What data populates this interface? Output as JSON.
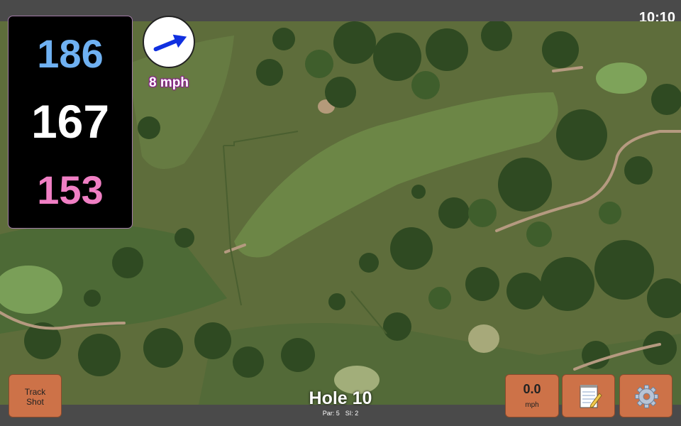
{
  "status_bar": {
    "time": "10:10"
  },
  "distances": {
    "back": {
      "value": "186",
      "color": "#6fb1f2"
    },
    "middle": {
      "value": "167",
      "color": "#ffffff"
    },
    "front": {
      "value": "153",
      "color": "#f07fc4"
    }
  },
  "wind": {
    "speed_label": "8 mph",
    "icon": "wind-direction-arrow-icon"
  },
  "buttons": {
    "track_shot": "Track\nShot",
    "wind_value": "0.0",
    "wind_unit": "mph",
    "notes_icon": "notepad-icon",
    "settings_icon": "gear-icon"
  },
  "hole": {
    "title": "Hole 10",
    "par": "Par: 5",
    "si": "SI: 2"
  },
  "colors": {
    "button": "#cd7248",
    "bar": "#4a4a4a"
  }
}
